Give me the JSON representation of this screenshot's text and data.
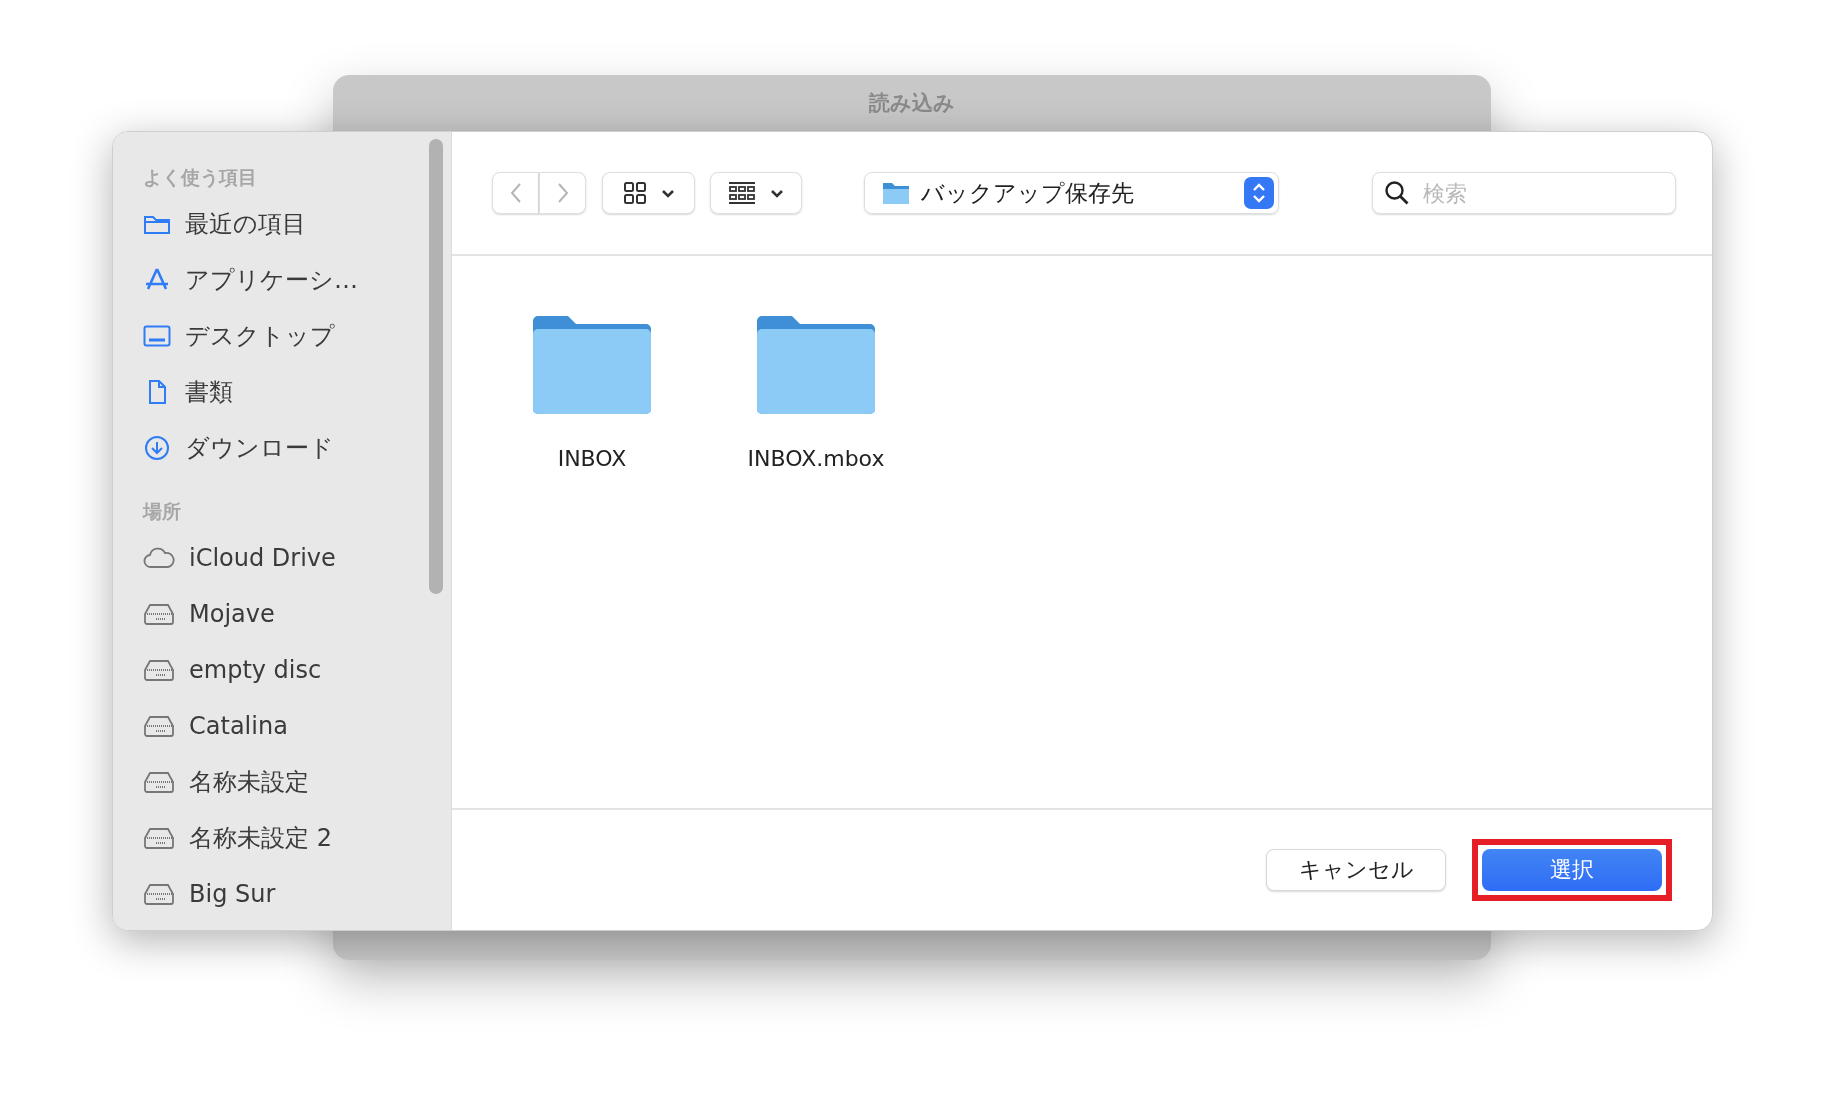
{
  "back_window": {
    "title": "読み込み"
  },
  "sidebar": {
    "sections": [
      {
        "title": "よく使う項目",
        "items": [
          {
            "label": "最近の項目",
            "kind": "folder"
          },
          {
            "label": "アプリケーシ…",
            "kind": "apps"
          },
          {
            "label": "デスクトップ",
            "kind": "desktop"
          },
          {
            "label": "書類",
            "kind": "document"
          },
          {
            "label": "ダウンロード",
            "kind": "download"
          }
        ]
      },
      {
        "title": "場所",
        "items": [
          {
            "label": "iCloud Drive",
            "kind": "cloud"
          },
          {
            "label": "Mojave",
            "kind": "disk"
          },
          {
            "label": "empty disc",
            "kind": "disk"
          },
          {
            "label": "Catalina",
            "kind": "disk"
          },
          {
            "label": "名称未設定",
            "kind": "disk"
          },
          {
            "label": "名称未設定 2",
            "kind": "disk"
          },
          {
            "label": "Big Sur",
            "kind": "disk"
          }
        ]
      }
    ]
  },
  "toolbar": {
    "back_disabled": true,
    "forward_disabled": true,
    "location": "バックアップ保存先",
    "search": {
      "placeholder": "検索"
    }
  },
  "files": [
    {
      "name": "INBOX"
    },
    {
      "name": "INBOX.mbox"
    }
  ],
  "buttons": [
    {
      "label": "キャンセル",
      "kind": "secondary",
      "highlighted": false
    },
    {
      "label": "選択",
      "kind": "primary",
      "highlighted": true
    }
  ]
}
